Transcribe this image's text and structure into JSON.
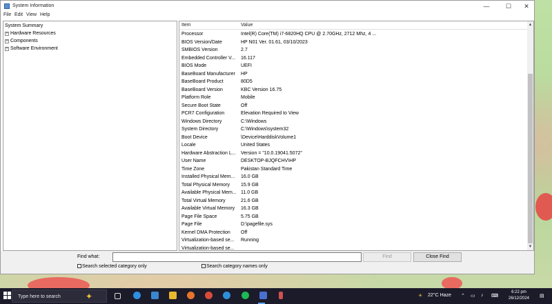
{
  "window": {
    "title": "System Information",
    "controls": {
      "minimize": "—",
      "maximize": "☐",
      "close": "✕"
    }
  },
  "menu": [
    "File",
    "Edit",
    "View",
    "Help"
  ],
  "tree": {
    "items": [
      {
        "label": "System Summary",
        "expander": ""
      },
      {
        "label": "Hardware Resources",
        "expander": "+"
      },
      {
        "label": "Components",
        "expander": "+"
      },
      {
        "label": "Software Environment",
        "expander": "+"
      }
    ]
  },
  "list": {
    "headers": {
      "item": "Item",
      "value": "Value"
    },
    "rows": [
      {
        "item": "Processor",
        "value": "Intel(R) Core(TM) i7-6820HQ CPU @ 2.70GHz, 2712 Mhz, 4 ..."
      },
      {
        "item": "BIOS Version/Date",
        "value": "HP N01 Ver. 01.61, 03/10/2023"
      },
      {
        "item": "SMBIOS Version",
        "value": "2.7"
      },
      {
        "item": "Embedded Controller V...",
        "value": "16.117"
      },
      {
        "item": "BIOS Mode",
        "value": "UEFI"
      },
      {
        "item": "BaseBoard Manufacturer",
        "value": "HP"
      },
      {
        "item": "BaseBoard Product",
        "value": "80D5"
      },
      {
        "item": "BaseBoard Version",
        "value": "KBC Version 16.75"
      },
      {
        "item": "Platform Role",
        "value": "Mobile"
      },
      {
        "item": "Secure Boot State",
        "value": "Off"
      },
      {
        "item": "PCR7 Configuration",
        "value": "Elevation Required to View"
      },
      {
        "item": "Windows Directory",
        "value": "C:\\Windows"
      },
      {
        "item": "System Directory",
        "value": "C:\\Windows\\system32"
      },
      {
        "item": "Boot Device",
        "value": "\\Device\\HarddiskVolume1"
      },
      {
        "item": "Locale",
        "value": "United States"
      },
      {
        "item": "Hardware Abstraction L...",
        "value": "Version = \"10.0.19041.5072\""
      },
      {
        "item": "User Name",
        "value": "DESKTOP-BJQFCHV\\HP"
      },
      {
        "item": "Time Zone",
        "value": "Pakistan Standard Time"
      },
      {
        "item": "Installed Physical Mem...",
        "value": "16.0 GB"
      },
      {
        "item": "Total Physical Memory",
        "value": "15.9 GB"
      },
      {
        "item": "Available Physical Mem...",
        "value": "11.0 GB"
      },
      {
        "item": "Total Virtual Memory",
        "value": "21.6 GB"
      },
      {
        "item": "Available Virtual Memory",
        "value": "16.3 GB"
      },
      {
        "item": "Page File Space",
        "value": "5.75 GB"
      },
      {
        "item": "Page File",
        "value": "D:\\pagefile.sys"
      },
      {
        "item": "Kernel DMA Protection",
        "value": "Off"
      },
      {
        "item": "Virtualization-based se...",
        "value": "Running"
      },
      {
        "item": "Virtualization-based se...",
        "value": ""
      }
    ]
  },
  "find": {
    "label": "Find what:",
    "value": "",
    "find_button": "Find",
    "close_find_button": "Close Find",
    "search_selected_label": "Search selected category only",
    "search_names_label": "Search category names only"
  },
  "taskbar": {
    "search_placeholder": "Type here to search",
    "weather": "22°C  Haze",
    "time": "6:22 pm",
    "date": "26/12/2024"
  },
  "colors": {
    "taskbar_bg": "#1b1b2a",
    "findbar_bg": "#f0f0f0",
    "accent": "#60a0ff"
  }
}
